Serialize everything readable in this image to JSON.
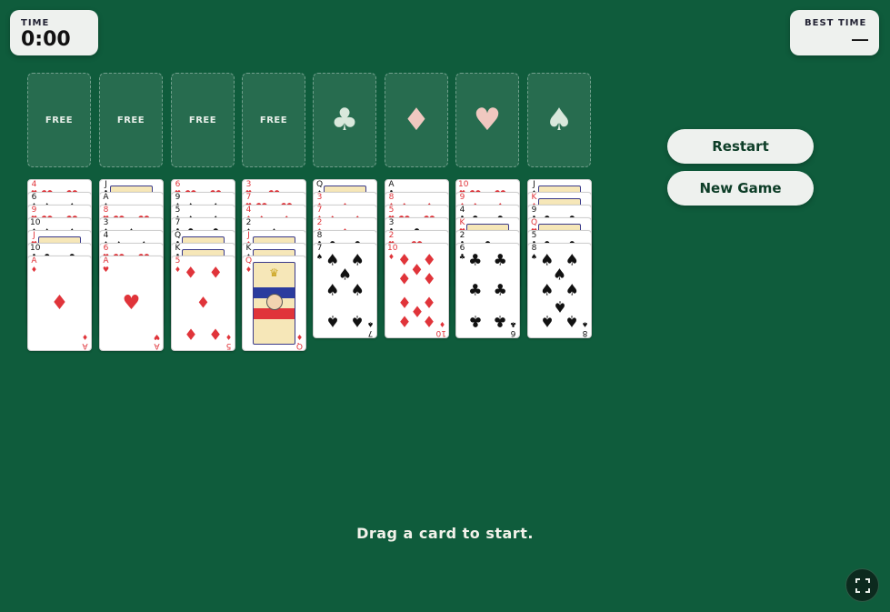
{
  "timer": {
    "label": "TIME",
    "value": "0:00"
  },
  "best_time": {
    "label": "BEST TIME",
    "value": "—"
  },
  "free_cells": [
    "FREE",
    "FREE",
    "FREE",
    "FREE"
  ],
  "foundations": [
    {
      "suit": "♣",
      "suit_name": "clubs",
      "color": "#d9e8dc"
    },
    {
      "suit": "♦",
      "suit_name": "diamonds",
      "color": "#f0c8c0"
    },
    {
      "suit": "♥",
      "suit_name": "hearts",
      "color": "#f0c8c0"
    },
    {
      "suit": "♠",
      "suit_name": "spades",
      "color": "#d9e8dc"
    }
  ],
  "buttons": {
    "restart": "Restart",
    "new_game": "New Game"
  },
  "tableau": [
    [
      {
        "r": "4",
        "s": "♥"
      },
      {
        "r": "6",
        "s": "♠"
      },
      {
        "r": "9",
        "s": "♥"
      },
      {
        "r": "10",
        "s": "♠"
      },
      {
        "r": "J",
        "s": "♥"
      },
      {
        "r": "10",
        "s": "♣"
      },
      {
        "r": "A",
        "s": "♦"
      }
    ],
    [
      {
        "r": "J",
        "s": "♣"
      },
      {
        "r": "A",
        "s": "♠"
      },
      {
        "r": "8",
        "s": "♥"
      },
      {
        "r": "3",
        "s": "♠"
      },
      {
        "r": "4",
        "s": "♠"
      },
      {
        "r": "6",
        "s": "♥"
      },
      {
        "r": "A",
        "s": "♥"
      }
    ],
    [
      {
        "r": "6",
        "s": "♥"
      },
      {
        "r": "9",
        "s": "♠"
      },
      {
        "r": "5",
        "s": "♠"
      },
      {
        "r": "7",
        "s": "♣"
      },
      {
        "r": "Q",
        "s": "♣"
      },
      {
        "r": "K",
        "s": "♣"
      },
      {
        "r": "5",
        "s": "♦"
      }
    ],
    [
      {
        "r": "3",
        "s": "♥"
      },
      {
        "r": "7",
        "s": "♥"
      },
      {
        "r": "4",
        "s": "♦"
      },
      {
        "r": "2",
        "s": "♠"
      },
      {
        "r": "J",
        "s": "♦"
      },
      {
        "r": "K",
        "s": "♠"
      },
      {
        "r": "Q",
        "s": "♦"
      }
    ],
    [
      {
        "r": "Q",
        "s": "♠"
      },
      {
        "r": "3",
        "s": "♦"
      },
      {
        "r": "7",
        "s": "♦"
      },
      {
        "r": "2",
        "s": "♦"
      },
      {
        "r": "8",
        "s": "♣"
      },
      {
        "r": "7",
        "s": "♠"
      }
    ],
    [
      {
        "r": "A",
        "s": "♣"
      },
      {
        "r": "8",
        "s": "♦"
      },
      {
        "r": "5",
        "s": "♥"
      },
      {
        "r": "3",
        "s": "♣"
      },
      {
        "r": "2",
        "s": "♥"
      },
      {
        "r": "10",
        "s": "♦"
      }
    ],
    [
      {
        "r": "10",
        "s": "♥"
      },
      {
        "r": "9",
        "s": "♦"
      },
      {
        "r": "4",
        "s": "♣"
      },
      {
        "r": "K",
        "s": "♥"
      },
      {
        "r": "2",
        "s": "♣"
      },
      {
        "r": "6",
        "s": "♣"
      }
    ],
    [
      {
        "r": "J",
        "s": "♠"
      },
      {
        "r": "K",
        "s": "♦"
      },
      {
        "r": "9",
        "s": "♣"
      },
      {
        "r": "Q",
        "s": "♥"
      },
      {
        "r": "5",
        "s": "♣"
      },
      {
        "r": "8",
        "s": "♠"
      }
    ]
  ],
  "status": "Drag a card to start.",
  "fullscreen_icon": "fullscreen-icon"
}
